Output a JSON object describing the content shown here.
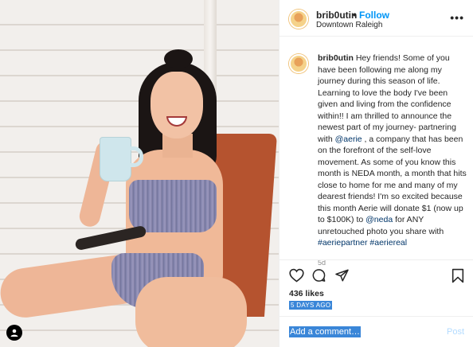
{
  "post": {
    "username": "brib0utin",
    "separator": "•",
    "follow_label": "Follow",
    "location": "Downtown Raleigh",
    "more_label": "•••"
  },
  "caption": {
    "username": "brib0utin",
    "text_1": "Hey friends! Some of you have been following me along my journey during this season of life. Learning to love the body I've been given and living from the confidence within!! I am thrilled to announce the newest part of my journey- partnering with",
    "mention_aerie": "@aerie",
    "text_2": ", a company that has been on the forefront of the self-love movement. As some of you know this month is NEDA month, a month that hits close to home for me and many of my dearest friends! I'm so excited because this month Aerie will donate $1 (now up to $100K) to",
    "mention_neda": "@neda",
    "text_3": "for ANY unretouched photo you share with",
    "hashtag_1": "#aeriepartner",
    "hashtag_2": "#aeriereal",
    "age": "5d"
  },
  "stats": {
    "likes": "436 likes",
    "date": "5 DAYS AGO"
  },
  "comment": {
    "placeholder": "Add a comment…",
    "post_label": "Post"
  },
  "icons": [
    "user-tag-icon",
    "heart-icon",
    "comment-icon",
    "share-icon",
    "bookmark-icon",
    "more-icon"
  ],
  "colors": {
    "link_blue": "#0095f6",
    "mention_blue": "#003569",
    "selection_blue": "#3a86d8",
    "post_disabled": "#b3dbff"
  }
}
